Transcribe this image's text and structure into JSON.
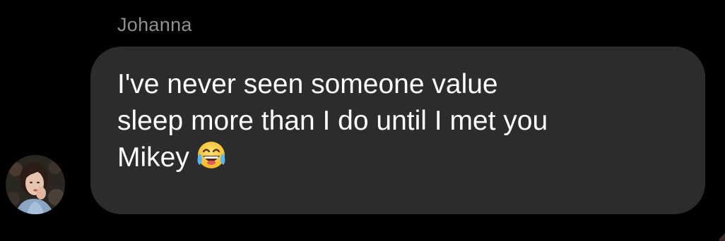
{
  "conversation": {
    "sender_name": "Johanna",
    "message_text": "I've never seen someone value\nsleep more than I do until I met you\nMikey",
    "emoji_icon": "face-with-tears-of-joy-icon",
    "avatar_icon": "contact-avatar-photo"
  },
  "colors": {
    "background": "#000000",
    "bubble": "#2c2c2e",
    "sender_text": "#8e8e93",
    "message_text": "#ffffff"
  }
}
